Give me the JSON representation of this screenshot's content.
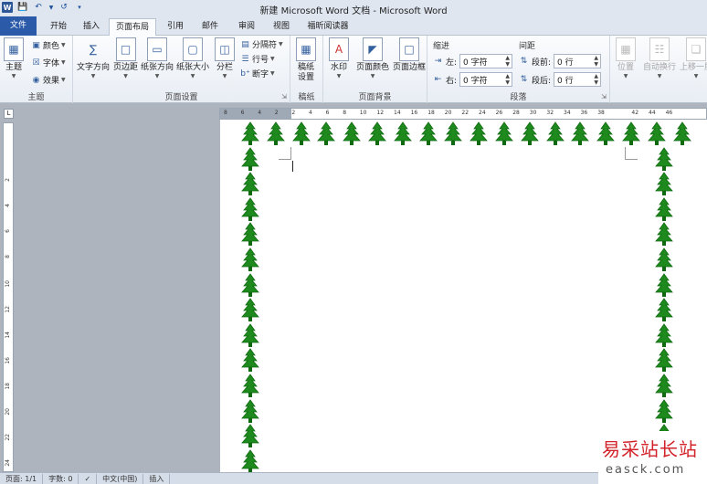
{
  "window": {
    "title": "新建 Microsoft Word 文档 - Microsoft Word"
  },
  "quick_access": {
    "app_icon": "W",
    "save_icon": "save-icon",
    "undo_icon": "undo-icon",
    "redo_icon": "redo-icon",
    "customize_icon": "customize-icon"
  },
  "tabs": [
    {
      "label": "文件"
    },
    {
      "label": "开始"
    },
    {
      "label": "插入"
    },
    {
      "label": "页面布局"
    },
    {
      "label": "引用"
    },
    {
      "label": "邮件"
    },
    {
      "label": "审阅"
    },
    {
      "label": "视图"
    },
    {
      "label": "福昕阅读器"
    }
  ],
  "ribbon": {
    "theme": {
      "label": "主题",
      "themes": "主题",
      "colors": "颜色",
      "fonts": "字体",
      "effects": "效果"
    },
    "page_setup": {
      "label": "页面设置",
      "text_direction": "文字方向",
      "margins": "页边距",
      "orientation": "纸张方向",
      "size": "纸张大小",
      "columns": "分栏",
      "breaks": "分隔符",
      "line_numbers": "行号",
      "hyphenation": "断字"
    },
    "manuscript": {
      "label": "稿纸",
      "setting_line1": "稿纸",
      "setting_line2": "设置"
    },
    "page_background": {
      "label": "页面背景",
      "watermark": "水印",
      "page_color": "页面颜色",
      "page_borders": "页面边框"
    },
    "paragraph": {
      "label": "段落",
      "indent": "缩进",
      "spacing": "间距",
      "left": "左:",
      "left_value": "0 字符",
      "right": "右:",
      "right_value": "0 字符",
      "before": "段前:",
      "before_value": "0 行",
      "after": "段后:",
      "after_value": "0 行"
    },
    "arrange": {
      "position": "位置",
      "wrap_text": "自动换行",
      "bring_forward": "上移一层"
    }
  },
  "ruler": {
    "h_ticks": [
      "8",
      "6",
      "4",
      "2",
      "2",
      "4",
      "6",
      "8",
      "10",
      "12",
      "14",
      "16",
      "18",
      "20",
      "22",
      "24",
      "26",
      "28",
      "30",
      "32",
      "34",
      "36",
      "38",
      "42",
      "44",
      "46"
    ],
    "v_ticks": [
      "2",
      "4",
      "6",
      "8",
      "10",
      "12",
      "14",
      "16",
      "18",
      "20",
      "22",
      "24"
    ]
  },
  "status": {
    "page": "页面: 1/1",
    "words": "字数: 0",
    "language": "中文(中国)",
    "mode": "插入"
  },
  "watermark": {
    "title": "易采站长站",
    "url": "easck.com"
  },
  "colors": {
    "tree": "#1e8a1e",
    "tree_dark": "#0f6a0f",
    "file_tab": "#2a5aa8"
  }
}
